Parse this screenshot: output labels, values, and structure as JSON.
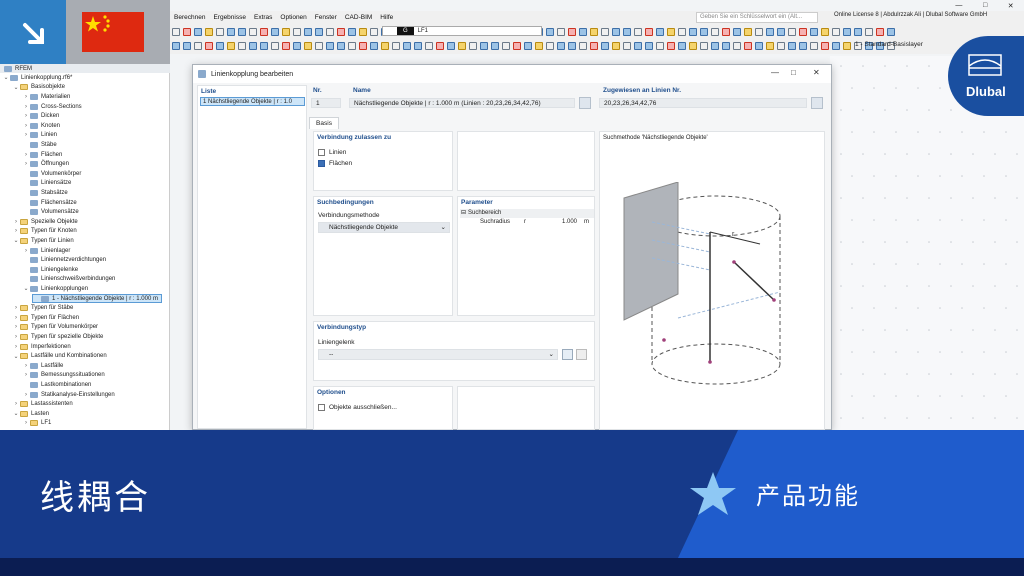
{
  "menu": [
    "Berechnen",
    "Ergebnisse",
    "Extras",
    "Optionen",
    "Fenster",
    "CAD-BIM",
    "Hilfe"
  ],
  "search_placeholder": "Geben Sie ein Schlüsselwort ein (Alt...",
  "license_text": "Online License 8 | Abdulrzzak Ali | Dlubal Software GmbH",
  "loadcase": {
    "g_label": "G",
    "lc_label": "LF1"
  },
  "layer_label": "1 - Standard-Basislayer",
  "tree": {
    "root_title": "RFEM",
    "items": [
      {
        "label": "Linienkopplung.rf6*",
        "level": 0,
        "arrow": "v",
        "icon": "ico"
      },
      {
        "label": "Basisobjekte",
        "level": 1,
        "arrow": "v",
        "icon": "fold"
      },
      {
        "label": "Materialien",
        "level": 2,
        "arrow": ">",
        "icon": "ico"
      },
      {
        "label": "Cross-Sections",
        "level": 2,
        "arrow": ">",
        "icon": "ico"
      },
      {
        "label": "Dicken",
        "level": 2,
        "arrow": ">",
        "icon": "ico"
      },
      {
        "label": "Knoten",
        "level": 2,
        "arrow": ">",
        "icon": "ico"
      },
      {
        "label": "Linien",
        "level": 2,
        "arrow": ">",
        "icon": "ico"
      },
      {
        "label": "Stäbe",
        "level": 2,
        "arrow": "",
        "icon": "ico"
      },
      {
        "label": "Flächen",
        "level": 2,
        "arrow": ">",
        "icon": "ico"
      },
      {
        "label": "Öffnungen",
        "level": 2,
        "arrow": ">",
        "icon": "ico"
      },
      {
        "label": "Volumenkörper",
        "level": 2,
        "arrow": "",
        "icon": "ico"
      },
      {
        "label": "Liniensätze",
        "level": 2,
        "arrow": "",
        "icon": "ico"
      },
      {
        "label": "Stabsätze",
        "level": 2,
        "arrow": "",
        "icon": "ico"
      },
      {
        "label": "Flächensätze",
        "level": 2,
        "arrow": "",
        "icon": "ico"
      },
      {
        "label": "Volumensätze",
        "level": 2,
        "arrow": "",
        "icon": "ico"
      },
      {
        "label": "Spezielle Objekte",
        "level": 1,
        "arrow": ">",
        "icon": "fold"
      },
      {
        "label": "Typen für Knoten",
        "level": 1,
        "arrow": ">",
        "icon": "fold"
      },
      {
        "label": "Typen für Linien",
        "level": 1,
        "arrow": "v",
        "icon": "fold"
      },
      {
        "label": "Linienlager",
        "level": 2,
        "arrow": ">",
        "icon": "ico"
      },
      {
        "label": "Liniennetzverdichtungen",
        "level": 2,
        "arrow": "",
        "icon": "ico"
      },
      {
        "label": "Liniengelenke",
        "level": 2,
        "arrow": "",
        "icon": "ico"
      },
      {
        "label": "Linienschweißverbindungen",
        "level": 2,
        "arrow": "",
        "icon": "ico"
      },
      {
        "label": "Linienkopplungen",
        "level": 2,
        "arrow": "v",
        "icon": "ico"
      },
      {
        "label": "1 - Nächstliegende Objekte | r : 1.000 m",
        "level": 3,
        "arrow": "",
        "icon": "ico",
        "selected": true
      },
      {
        "label": "Typen für Stäbe",
        "level": 1,
        "arrow": ">",
        "icon": "fold"
      },
      {
        "label": "Typen für Flächen",
        "level": 1,
        "arrow": ">",
        "icon": "fold"
      },
      {
        "label": "Typen für Volumenkörper",
        "level": 1,
        "arrow": ">",
        "icon": "fold"
      },
      {
        "label": "Typen für spezielle Objekte",
        "level": 1,
        "arrow": ">",
        "icon": "fold"
      },
      {
        "label": "Imperfektionen",
        "level": 1,
        "arrow": ">",
        "icon": "fold"
      },
      {
        "label": "Lastfälle und Kombinationen",
        "level": 1,
        "arrow": "v",
        "icon": "fold"
      },
      {
        "label": "Lastfälle",
        "level": 2,
        "arrow": ">",
        "icon": "ico"
      },
      {
        "label": "Bemessungssituationen",
        "level": 2,
        "arrow": ">",
        "icon": "ico"
      },
      {
        "label": "Lastkombinationen",
        "level": 2,
        "arrow": "",
        "icon": "ico"
      },
      {
        "label": "Statikanalyse-Einstellungen",
        "level": 2,
        "arrow": ">",
        "icon": "ico"
      },
      {
        "label": "Lastassistenten",
        "level": 1,
        "arrow": ">",
        "icon": "fold"
      },
      {
        "label": "Lasten",
        "level": 1,
        "arrow": "v",
        "icon": "fold"
      },
      {
        "label": "LF1",
        "level": 2,
        "arrow": ">",
        "icon": "fold"
      }
    ]
  },
  "dialog": {
    "title": "Linienkopplung bearbeiten",
    "list_header": "Liste",
    "list_item": "1  Nächstliegende Objekte | r : 1.0",
    "nr_label": "Nr.",
    "nr_value": "1",
    "name_label": "Name",
    "name_value": "Nächstliegende Objekte | r : 1.000 m (Linien : 20,23,26,34,42,76)",
    "assigned_label": "Zugewiesen an Linien Nr.",
    "assigned_value": "20,23,26,34,42,76",
    "tab_basis": "Basis",
    "sec_connection": "Verbindung zulassen zu",
    "chk_lines": "Linien",
    "chk_surfaces": "Flächen",
    "sec_search": "Suchbedingungen",
    "method_label": "Verbindungsmethode",
    "method_value": "Nächstliegende Objekte",
    "sec_params": "Parameter",
    "param_group": "Suchbereich",
    "param_name": "Suchradius",
    "param_symbol": "r",
    "param_value": "1.000",
    "param_unit": "m",
    "sec_conntype": "Verbindungstyp",
    "hinge_label": "Liniengelenk",
    "hinge_value": "--",
    "sec_options": "Optionen",
    "chk_exclude": "Objekte ausschließen...",
    "illustration_title": "Suchmethode 'Nächstliegende Objekte'",
    "illu_r": "r"
  },
  "logo_text": "Dlubal",
  "banner": {
    "title": "线耦合",
    "feature": "产品功能"
  }
}
